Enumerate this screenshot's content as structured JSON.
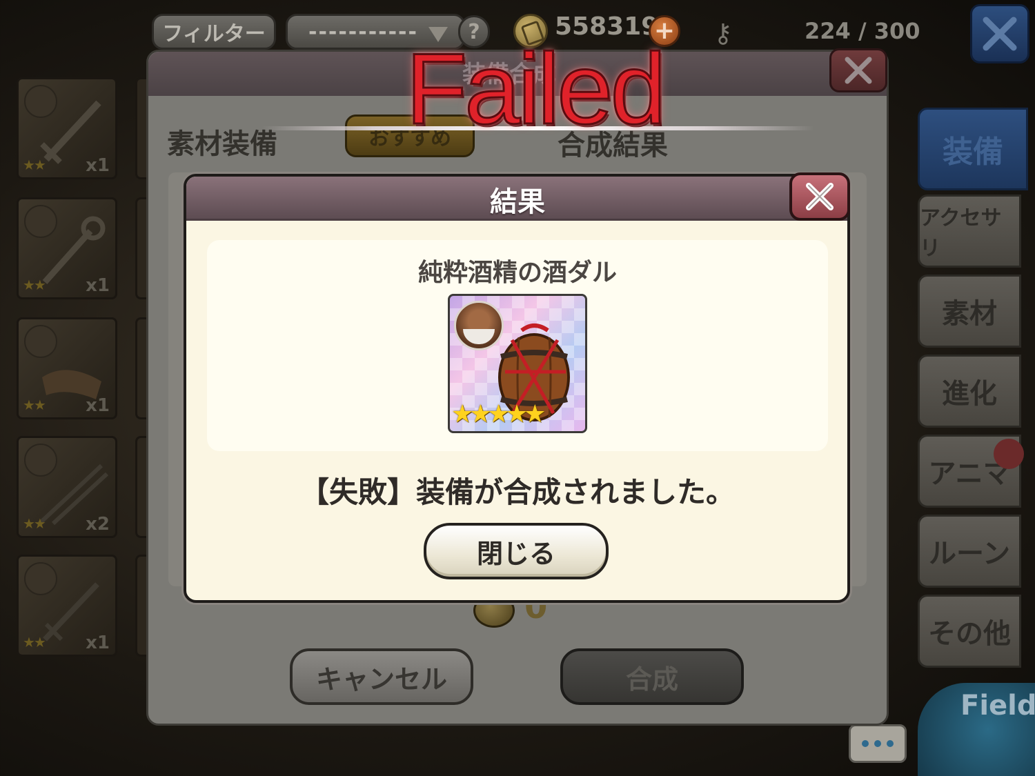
{
  "topbar": {
    "filter_label": "フィルター",
    "filter_value": "-----------",
    "help_label": "?",
    "gold_amount": "558319",
    "gold_add_label": "+",
    "inventory_count": "224 / 300"
  },
  "inventory": {
    "slots": [
      {
        "stars": "★★",
        "qty": "x1",
        "icon": "sword-icon"
      },
      {
        "stars": "★★",
        "qty": "x1",
        "icon": "staff-icon"
      },
      {
        "stars": "★★",
        "qty": "x1",
        "icon": "armor-icon"
      },
      {
        "stars": "★★",
        "qty": "x2",
        "icon": "twin-blades-icon"
      },
      {
        "stars": "★★",
        "qty": "x1",
        "icon": "dagger-icon"
      }
    ]
  },
  "side_tabs": {
    "equipment": "装備",
    "accessory": "アクセサリ",
    "material": "素材",
    "evolve": "進化",
    "anima": "アニマ",
    "rune": "ルーン",
    "other": "その他"
  },
  "field_label": "Field",
  "synthesis": {
    "title": "装備合成",
    "material_label": "素材装備",
    "recommend_label": "おすすめ",
    "result_label": "合成結果",
    "cost_value": "0",
    "cancel_label": "キャンセル",
    "compose_label": "合成"
  },
  "failed_text": "Failed",
  "result_modal": {
    "title": "結果",
    "item_name": "純粋酒精の酒ダル",
    "item_stars": "★★★★★",
    "message": "【失敗】装備が合成されました。",
    "close_label": "閉じる"
  },
  "colors": {
    "failed_red": "#e0222a",
    "modal_bg": "#fbf6e3",
    "header_mauve": "#8a727a",
    "close_red": "#c7717a",
    "tab_blue": "#2e4f7f",
    "star_gold": "#ffd21e"
  }
}
